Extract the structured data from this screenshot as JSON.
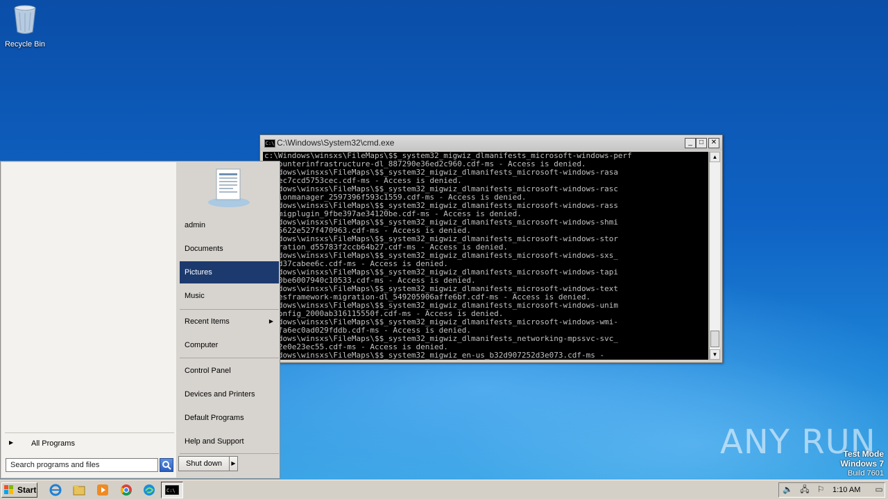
{
  "desktop": {
    "recycle_bin_label": "Recycle Bin"
  },
  "cmd": {
    "title": "C:\\Windows\\System32\\cmd.exe",
    "lines": [
      "c:\\Windows\\winsxs\\FileMaps\\$$_system32_migwiz_dlmanifests_microsoft-windows-perf",
      "ancounterinfrastructure-dl_887290e36ed2c960.cdf-ms - Access is denied.",
      "Windows\\winsxs\\FileMaps\\$$_system32_migwiz_dlmanifests_microsoft-windows-rasa",
      "86cec7ccd5753cec.cdf-ms - Access is denied.",
      "Windows\\winsxs\\FileMaps\\$$_system32_migwiz_dlmanifests_microsoft-windows-rasc",
      "ectionmanager_2597396f593c1559.cdf-ms - Access is denied.",
      "Windows\\winsxs\\FileMaps\\$$_system32_migwiz_dlmanifests_microsoft-windows-rass",
      "er-migplugin_9fbe397ae34120be.cdf-ms - Access is denied.",
      "Windows\\winsxs\\FileMaps\\$$_system32_migwiz_dlmanifests_microsoft-windows-shmi",
      "l_45622e527f470963.cdf-ms - Access is denied.",
      "Windows\\winsxs\\FileMaps\\$$_system32_migwiz_dlmanifests_microsoft-windows-stor",
      "migration_d55783f2ccb64b27.cdf-ms - Access is denied.",
      "Windows\\winsxs\\FileMaps\\$$_system32_migwiz_dlmanifests_microsoft-windows-sxs_",
      "556d37cabee6c.cdf-ms - Access is denied.",
      "Windows\\winsxs\\FileMaps\\$$_system32_migwiz_dlmanifests_microsoft-windows-tapi",
      "up_0be6007940c10533.cdf-ms - Access is denied.",
      "Windows\\winsxs\\FileMaps\\$$_system32_migwiz_dlmanifests_microsoft-windows-text",
      "vicesframework-migration-dl_549205906affe6bf.cdf-ms - Access is denied.",
      "Windows\\winsxs\\FileMaps\\$$_system32_migwiz_dlmanifests_microsoft-windows-unim",
      "m-config_2000ab316115550f.cdf-ms - Access is denied.",
      "Windows\\winsxs\\FileMaps\\$$_system32_migwiz_dlmanifests_microsoft-windows-wmi-",
      "e_0fa6ec0ad029fddb.cdf-ms - Access is denied.",
      "Windows\\winsxs\\FileMaps\\$$_system32_migwiz_dlmanifests_networking-mpssvc-svc_",
      "ab12e0e23ec55.cdf-ms - Access is denied.",
      "Windows\\winsxs\\FileMaps\\$$_system32_migwiz_en-us_b32d907252d3e073.cdf-ms -"
    ]
  },
  "start_menu": {
    "right_items": {
      "admin": "admin",
      "documents": "Documents",
      "pictures": "Pictures",
      "music": "Music",
      "recent_items": "Recent Items",
      "computer": "Computer",
      "control_panel": "Control Panel",
      "devices_printers": "Devices and Printers",
      "default_programs": "Default Programs",
      "help_support": "Help and Support"
    },
    "all_programs": "All Programs",
    "search_placeholder": "Search programs and files",
    "shutdown_label": "Shut down"
  },
  "watermark": {
    "brand": "ANY RUN",
    "test_mode": "Test Mode",
    "os": "Windows 7",
    "build": "Build 7601"
  },
  "taskbar": {
    "start_label": "Start",
    "clock": "1:10 AM"
  }
}
